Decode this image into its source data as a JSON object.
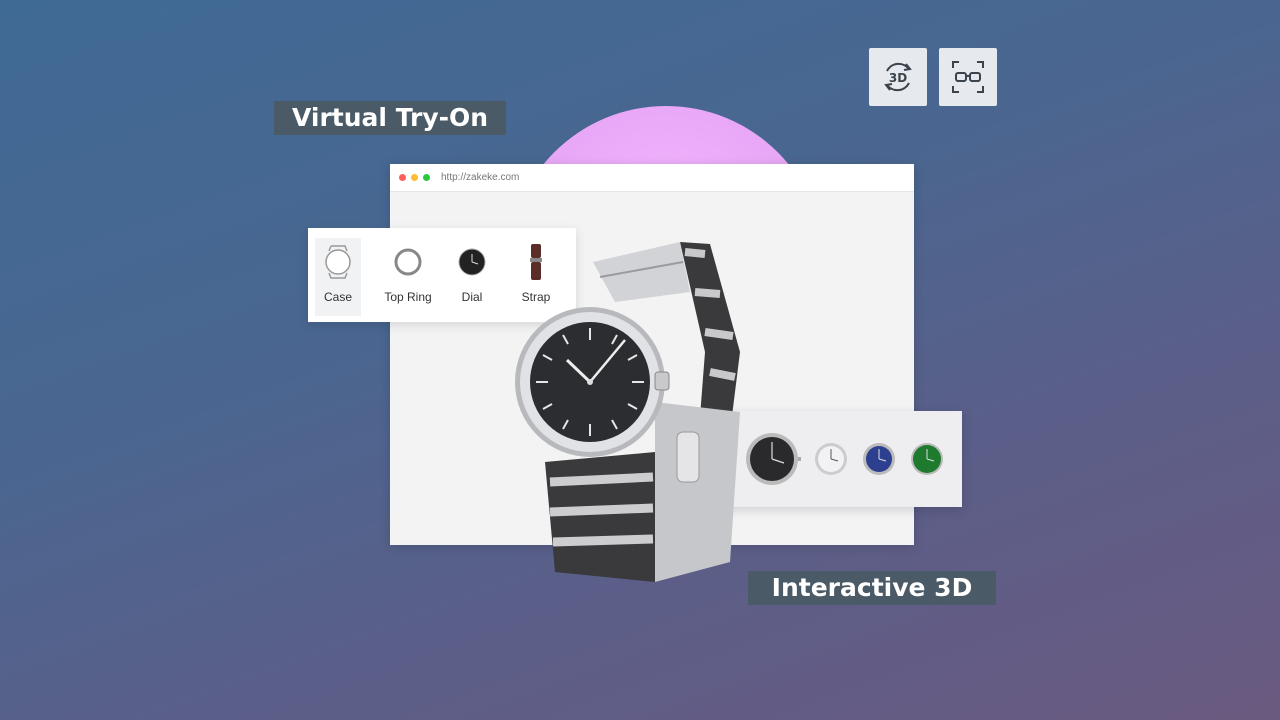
{
  "labels": {
    "tryon": "Virtual Try-On",
    "interactive": "Interactive 3D"
  },
  "browser": {
    "url": "http://zakeke.com"
  },
  "parts": [
    {
      "label": "Case",
      "icon": "case-icon",
      "selected": true
    },
    {
      "label": "Top Ring",
      "icon": "ring-icon",
      "selected": false
    },
    {
      "label": "Dial",
      "icon": "dial-icon",
      "selected": false
    },
    {
      "label": "Strap",
      "icon": "strap-icon",
      "selected": false
    }
  ],
  "dial_options": [
    {
      "color": "#2a2a2d"
    },
    {
      "color": "#f2f2f4"
    },
    {
      "color": "#2d3f8f"
    },
    {
      "color": "#1e7a2e"
    }
  ],
  "toolbar": {
    "icon_3d": "rotate-3d-icon",
    "icon_tryon": "ar-glasses-icon"
  }
}
